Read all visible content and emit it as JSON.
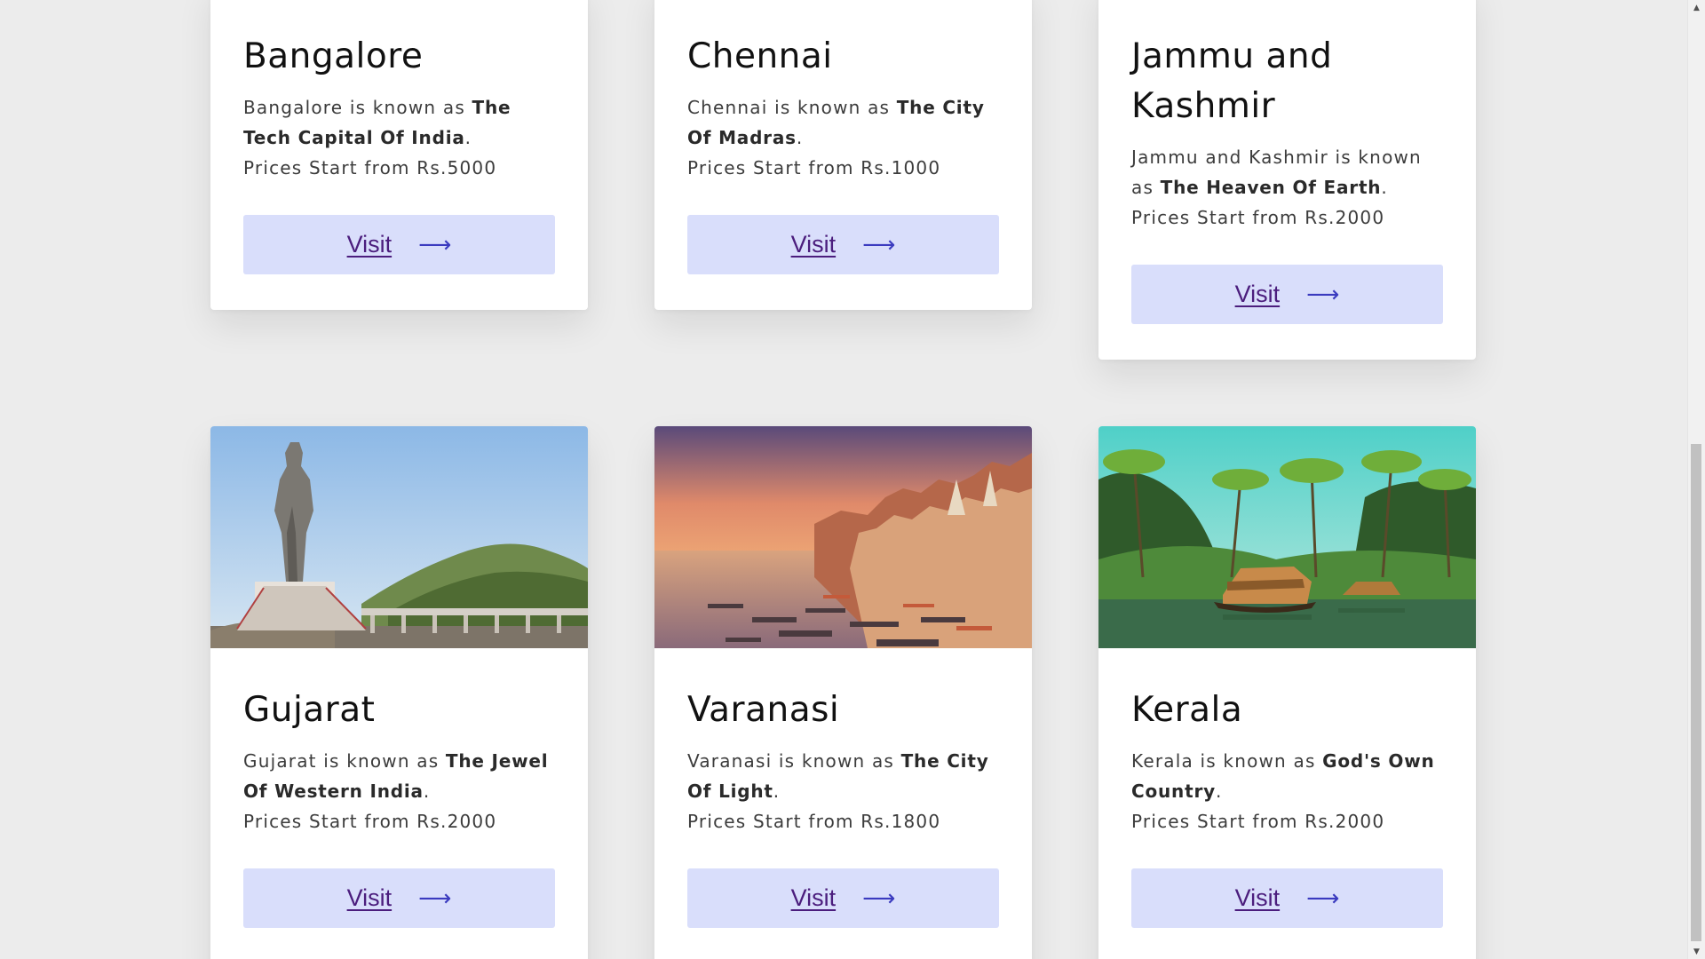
{
  "visit_label": "Visit",
  "arrow_glyph": "⟶",
  "price_prefix": "Prices Start from ",
  "top_cards": [
    {
      "name": "Bangalore",
      "desc_before": "Bangalore is known as ",
      "desc_bold": "The Tech Capital Of India",
      "desc_after": ".",
      "price": "Rs.5000"
    },
    {
      "name": "Chennai",
      "desc_before": "Chennai is known as ",
      "desc_bold": "The City Of Madras",
      "desc_after": ".",
      "price": "Rs.1000"
    },
    {
      "name": "Jammu and Kashmir",
      "desc_before": "Jammu and Kashmir is known as ",
      "desc_bold": "The Heaven Of Earth",
      "desc_after": ".",
      "price": "Rs.2000"
    }
  ],
  "bottom_cards": [
    {
      "name": "Gujarat",
      "image_icon": "statue-of-unity-photo",
      "desc_before": "Gujarat is known as ",
      "desc_bold": "The Jewel Of Western India",
      "desc_after": ".",
      "price": "Rs.2000"
    },
    {
      "name": "Varanasi",
      "image_icon": "varanasi-ghats-photo",
      "desc_before": "Varanasi is known as ",
      "desc_bold": "The City Of Light",
      "desc_after": ".",
      "price": "Rs.1800"
    },
    {
      "name": "Kerala",
      "image_icon": "kerala-backwaters-photo",
      "desc_before": "Kerala is known as ",
      "desc_bold": "God's Own Country",
      "desc_after": ".",
      "price": "Rs.2000"
    }
  ],
  "colors": {
    "page_bg": "#ececec",
    "card_bg": "#ffffff",
    "button_bg": "#d9defb",
    "visit_text": "#4b1d7d",
    "arrow": "#3b3bbf"
  },
  "scrollbar": {
    "up_icon": "▲",
    "down_icon": "▼"
  }
}
